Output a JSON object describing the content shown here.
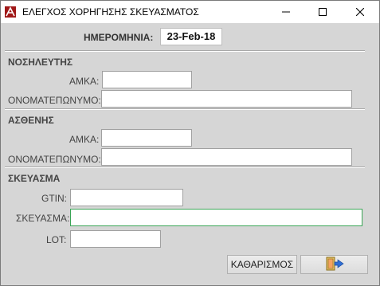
{
  "window": {
    "title": "ΕΛΕΓΧΟΣ ΧΟΡΗΓΗΣΗΣ ΣΚΕΥΑΣΜΑΤΟΣ"
  },
  "date": {
    "label": "ΗΜΕΡΟΜΗΝΙΑ:",
    "value": "23-Feb-18"
  },
  "nurse": {
    "section_label": "ΝΟΣΗΛΕΥΤΗΣ",
    "amka_label": "ΑΜΚΑ:",
    "amka_value": "",
    "name_label": "ΟΝΟΜΑΤΕΠΩΝΥΜΟ:",
    "name_value": ""
  },
  "patient": {
    "section_label": "ΑΣΘΕΝΗΣ",
    "amka_label": "ΑΜΚΑ:",
    "amka_value": "",
    "name_label": "ΟΝΟΜΑΤΕΠΩΝΥΜΟ:",
    "name_value": ""
  },
  "product": {
    "section_label": "ΣΚΕΥΑΣΜΑ",
    "gtin_label": "GTIN:",
    "gtin_value": "",
    "product_label": "ΣΚΕΥΑΣΜΑ:",
    "product_value": "",
    "lot_label": "LOT:",
    "lot_value": ""
  },
  "buttons": {
    "clear_label": "ΚΑΘΑΡΙΣΜΟΣ",
    "exit_icon": "exit-door-icon"
  },
  "colors": {
    "window_bg": "#d6d6d6",
    "active_border": "#3aa556"
  }
}
